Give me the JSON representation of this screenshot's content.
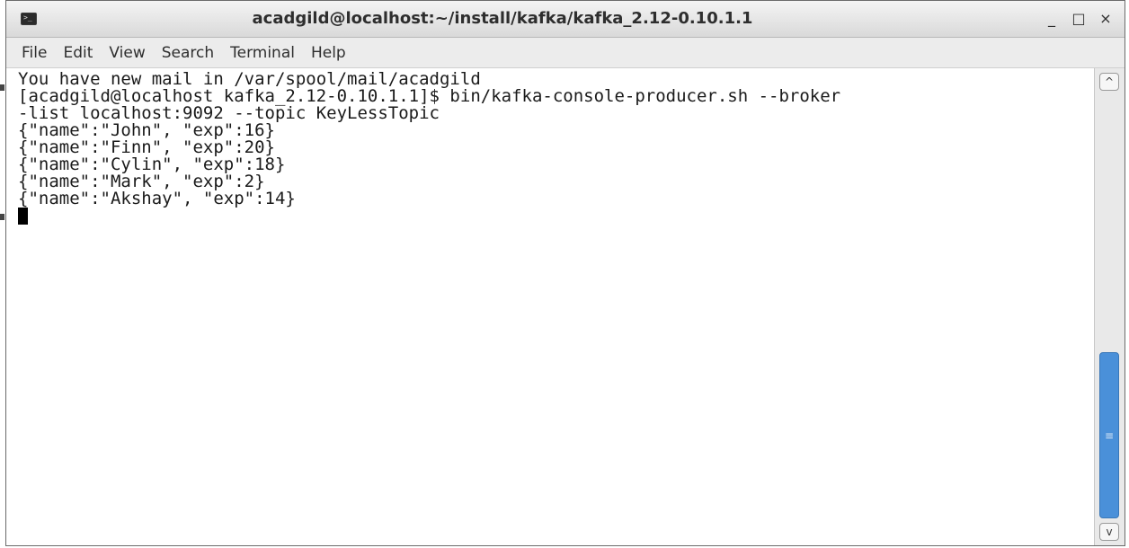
{
  "window": {
    "title": "acadgild@localhost:~/install/kafka/kafka_2.12-0.10.1.1",
    "icon": "terminal-icon",
    "controls": {
      "minimize": "_",
      "maximize": "□",
      "close": "×"
    }
  },
  "menubar": {
    "items": [
      "File",
      "Edit",
      "View",
      "Search",
      "Terminal",
      "Help"
    ]
  },
  "terminal": {
    "lines": [
      "You have new mail in /var/spool/mail/acadgild",
      "[acadgild@localhost kafka_2.12-0.10.1.1]$ bin/kafka-console-producer.sh --broker",
      "-list localhost:9092 --topic KeyLessTopic",
      "{\"name\":\"John\", \"exp\":16}",
      "{\"name\":\"Finn\", \"exp\":20}",
      "{\"name\":\"Cylin\", \"exp\":18}",
      "{\"name\":\"Mark\", \"exp\":2}",
      "{\"name\":\"Akshay\", \"exp\":14}"
    ]
  },
  "scrollbar": {
    "up_icon": "chevron-up-icon",
    "down_icon": "chevron-down-icon",
    "grip": "≡",
    "up_glyph": "^",
    "down_glyph": "v"
  },
  "colors": {
    "accent": "#4a90d9",
    "terminal_bg": "#ffffff",
    "terminal_fg": "#1a1a1a"
  }
}
